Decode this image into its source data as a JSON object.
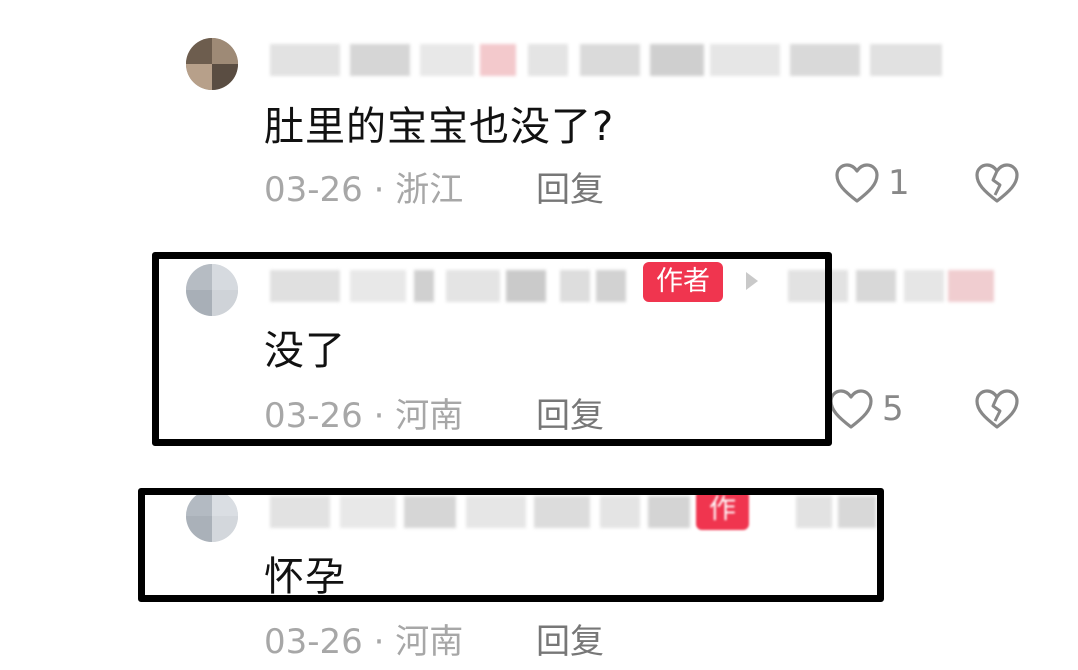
{
  "comments": [
    {
      "text": "肚里的宝宝也没了?",
      "date": "03-26",
      "separator": "·",
      "location": "浙江",
      "reply_label": "回复",
      "like_count": "1"
    },
    {
      "text": "没了",
      "badge": "作者",
      "date": "03-26",
      "separator": "·",
      "location": "河南",
      "reply_label": "回复",
      "like_count": "5"
    },
    {
      "text": "怀孕",
      "badge": "作",
      "date": "03-26",
      "separator": "·",
      "location": "河南",
      "reply_label": "回复"
    }
  ],
  "colors": {
    "badge_bg": "#f0354f",
    "highlight_box": "#000000",
    "meta_text": "#a7a7a7"
  },
  "icons": [
    "heart-outline-icon",
    "broken-heart-icon",
    "play-arrow-icon"
  ]
}
